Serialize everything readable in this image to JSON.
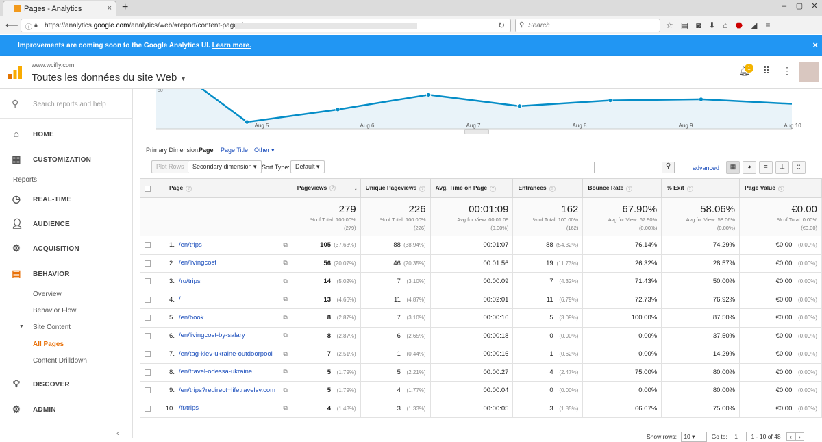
{
  "browser": {
    "tab_title": "Pages - Analytics",
    "tab_close": "×",
    "new_tab": "+",
    "url_prefix": "https://analytics.",
    "url_host": "google.com",
    "url_rest": "/analytics/web/#report/content-pages/",
    "search_placeholder": "Search"
  },
  "banner": {
    "text": "Improvements are coming soon to the Google Analytics UI.",
    "link": "Learn more.",
    "close": "×"
  },
  "header": {
    "site": "www.wcifly.com",
    "property": "Toutes les données du site Web",
    "notifications": "1"
  },
  "sidebar": {
    "search_placeholder": "Search reports and help",
    "home": "HOME",
    "customization": "CUSTOMIZATION",
    "reports": "Reports",
    "realtime": "REAL-TIME",
    "audience": "AUDIENCE",
    "acquisition": "ACQUISITION",
    "behavior": "BEHAVIOR",
    "overview": "Overview",
    "behavior_flow": "Behavior Flow",
    "site_content": "Site Content",
    "all_pages": "All Pages",
    "content_drilldown": "Content Drilldown",
    "discover": "DISCOVER",
    "admin": "ADMIN"
  },
  "chart": {
    "x_labels": [
      "...",
      "Aug 5",
      "Aug 6",
      "Aug 7",
      "Aug 8",
      "Aug 9",
      "Aug 10"
    ],
    "values": [
      105,
      46,
      57,
      70,
      60,
      65,
      66,
      62
    ],
    "ytick": "50",
    "line_color": "#058dc7"
  },
  "controls": {
    "primary_dimension": "Primary Dimension:",
    "page": "Page",
    "page_title": "Page Title",
    "other": "Other ▾",
    "plot_rows": "Plot Rows",
    "secondary": "Secondary dimension ▾",
    "sort_type": "Sort Type:",
    "default": "Default ▾",
    "advanced": "advanced"
  },
  "table": {
    "headers": [
      "Page",
      "Pageviews",
      "Unique Pageviews",
      "Avg. Time on Page",
      "Entrances",
      "Bounce Rate",
      "% Exit",
      "Page Value"
    ],
    "totals": [
      {
        "big": "279",
        "s1": "% of Total: 100.00%",
        "s2": "(279)"
      },
      {
        "big": "226",
        "s1": "% of Total: 100.00%",
        "s2": "(226)"
      },
      {
        "big": "00:01:09",
        "s1": "Avg for View: 00:01:09",
        "s2": "(0.00%)"
      },
      {
        "big": "162",
        "s1": "% of Total: 100.00%",
        "s2": "(162)"
      },
      {
        "big": "67.90%",
        "s1": "Avg for View: 67.90%",
        "s2": "(0.00%)"
      },
      {
        "big": "58.06%",
        "s1": "Avg for View: 58.06%",
        "s2": "(0.00%)"
      },
      {
        "big": "€0.00",
        "s1": "% of Total: 0.00%",
        "s2": "(€0.00)"
      }
    ],
    "rows": [
      {
        "n": "1.",
        "page": "/en/trips",
        "pv": "105",
        "pvp": "(37.63%)",
        "up": "88",
        "upp": "(38.94%)",
        "t": "00:01:07",
        "e": "88",
        "ep": "(54.32%)",
        "b": "76.14%",
        "x": "74.29%",
        "v": "€0.00",
        "vp": "(0.00%)"
      },
      {
        "n": "2.",
        "page": "/en/livingcost",
        "pv": "56",
        "pvp": "(20.07%)",
        "up": "46",
        "upp": "(20.35%)",
        "t": "00:01:56",
        "e": "19",
        "ep": "(11.73%)",
        "b": "26.32%",
        "x": "28.57%",
        "v": "€0.00",
        "vp": "(0.00%)"
      },
      {
        "n": "3.",
        "page": "/ru/trips",
        "pv": "14",
        "pvp": "(5.02%)",
        "up": "7",
        "upp": "(3.10%)",
        "t": "00:00:09",
        "e": "7",
        "ep": "(4.32%)",
        "b": "71.43%",
        "x": "50.00%",
        "v": "€0.00",
        "vp": "(0.00%)"
      },
      {
        "n": "4.",
        "page": "/",
        "pv": "13",
        "pvp": "(4.66%)",
        "up": "11",
        "upp": "(4.87%)",
        "t": "00:02:01",
        "e": "11",
        "ep": "(6.79%)",
        "b": "72.73%",
        "x": "76.92%",
        "v": "€0.00",
        "vp": "(0.00%)"
      },
      {
        "n": "5.",
        "page": "/en/book",
        "pv": "8",
        "pvp": "(2.87%)",
        "up": "7",
        "upp": "(3.10%)",
        "t": "00:00:16",
        "e": "5",
        "ep": "(3.09%)",
        "b": "100.00%",
        "x": "87.50%",
        "v": "€0.00",
        "vp": "(0.00%)"
      },
      {
        "n": "6.",
        "page": "/en/livingcost-by-salary",
        "pv": "8",
        "pvp": "(2.87%)",
        "up": "6",
        "upp": "(2.65%)",
        "t": "00:00:18",
        "e": "0",
        "ep": "(0.00%)",
        "b": "0.00%",
        "x": "37.50%",
        "v": "€0.00",
        "vp": "(0.00%)"
      },
      {
        "n": "7.",
        "page": "/en/tag-kiev-ukraine-outdoorpool",
        "pv": "7",
        "pvp": "(2.51%)",
        "up": "1",
        "upp": "(0.44%)",
        "t": "00:00:16",
        "e": "1",
        "ep": "(0.62%)",
        "b": "0.00%",
        "x": "14.29%",
        "v": "€0.00",
        "vp": "(0.00%)"
      },
      {
        "n": "8.",
        "page": "/en/travel-odessa-ukraine",
        "pv": "5",
        "pvp": "(1.79%)",
        "up": "5",
        "upp": "(2.21%)",
        "t": "00:00:27",
        "e": "4",
        "ep": "(2.47%)",
        "b": "75.00%",
        "x": "80.00%",
        "v": "€0.00",
        "vp": "(0.00%)"
      },
      {
        "n": "9.",
        "page": "/en/trips?redirect=lifetravelsv.com",
        "pv": "5",
        "pvp": "(1.79%)",
        "up": "4",
        "upp": "(1.77%)",
        "t": "00:00:04",
        "e": "0",
        "ep": "(0.00%)",
        "b": "0.00%",
        "x": "80.00%",
        "v": "€0.00",
        "vp": "(0.00%)"
      },
      {
        "n": "10.",
        "page": "/fr/trips",
        "pv": "4",
        "pvp": "(1.43%)",
        "up": "3",
        "upp": "(1.33%)",
        "t": "00:00:05",
        "e": "3",
        "ep": "(1.85%)",
        "b": "66.67%",
        "x": "75.00%",
        "v": "€0.00",
        "vp": "(0.00%)"
      }
    ]
  },
  "footer": {
    "show_rows": "Show rows:",
    "rows_value": "10",
    "goto": "Go to:",
    "goto_value": "1",
    "range": "1 - 10 of 48"
  }
}
